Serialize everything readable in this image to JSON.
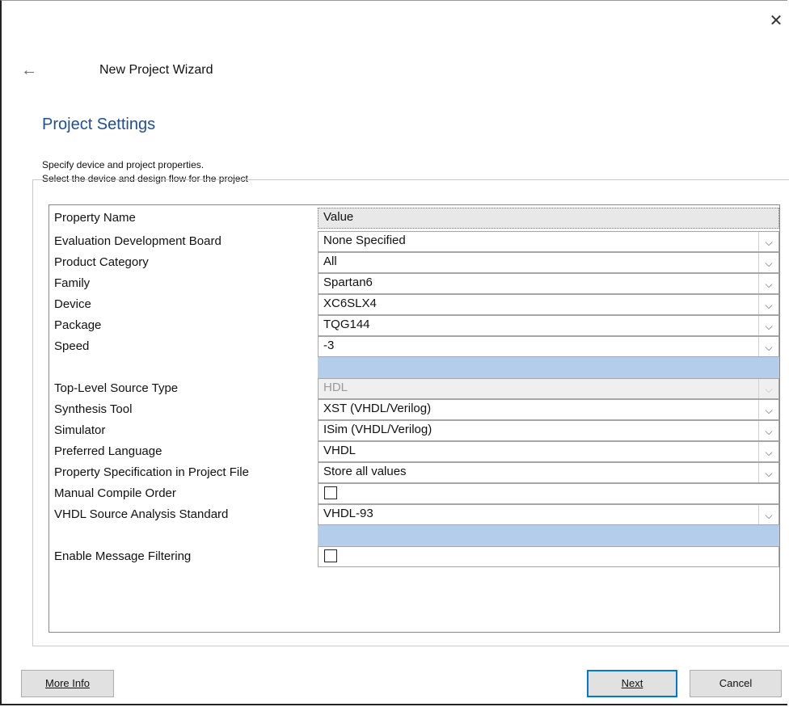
{
  "window": {
    "title": "New Project Wizard",
    "close_glyph": "✕",
    "back_glyph": "←"
  },
  "page": {
    "heading": "Project Settings",
    "description_line1": "Specify device and project properties.",
    "description_line2": "Select the device and design flow for the project"
  },
  "grid": {
    "header": {
      "name": "Property Name",
      "value": "Value"
    },
    "rows": [
      {
        "name": "Evaluation Development Board",
        "value": "None Specified",
        "type": "dropdown"
      },
      {
        "name": "Product Category",
        "value": "All",
        "type": "dropdown"
      },
      {
        "name": "Family",
        "value": "Spartan6",
        "type": "dropdown"
      },
      {
        "name": "Device",
        "value": "XC6SLX4",
        "type": "dropdown"
      },
      {
        "name": "Package",
        "value": "TQG144",
        "type": "dropdown"
      },
      {
        "name": "Speed",
        "value": "-3",
        "type": "dropdown"
      },
      {
        "name": "",
        "value": "",
        "type": "blank"
      },
      {
        "name": "Top-Level Source Type",
        "value": "HDL",
        "type": "dropdown-disabled"
      },
      {
        "name": "Synthesis Tool",
        "value": "XST (VHDL/Verilog)",
        "type": "dropdown"
      },
      {
        "name": "Simulator",
        "value": "ISim (VHDL/Verilog)",
        "type": "dropdown"
      },
      {
        "name": "Preferred Language",
        "value": "VHDL",
        "type": "dropdown"
      },
      {
        "name": "Property Specification in Project File",
        "value": "Store all values",
        "type": "dropdown"
      },
      {
        "name": "Manual Compile Order",
        "value": "",
        "type": "checkbox",
        "checked": false
      },
      {
        "name": "VHDL Source Analysis Standard",
        "value": "VHDL-93",
        "type": "dropdown"
      },
      {
        "name": "",
        "value": "",
        "type": "blank"
      },
      {
        "name": "Enable Message Filtering",
        "value": "",
        "type": "checkbox",
        "checked": false
      }
    ]
  },
  "buttons": {
    "more_info": "More Info",
    "next": "Next",
    "cancel": "Cancel"
  },
  "colors": {
    "heading": "#1f4e9a",
    "selected_row": "#b3cdea",
    "primary_border": "#0078d7"
  }
}
